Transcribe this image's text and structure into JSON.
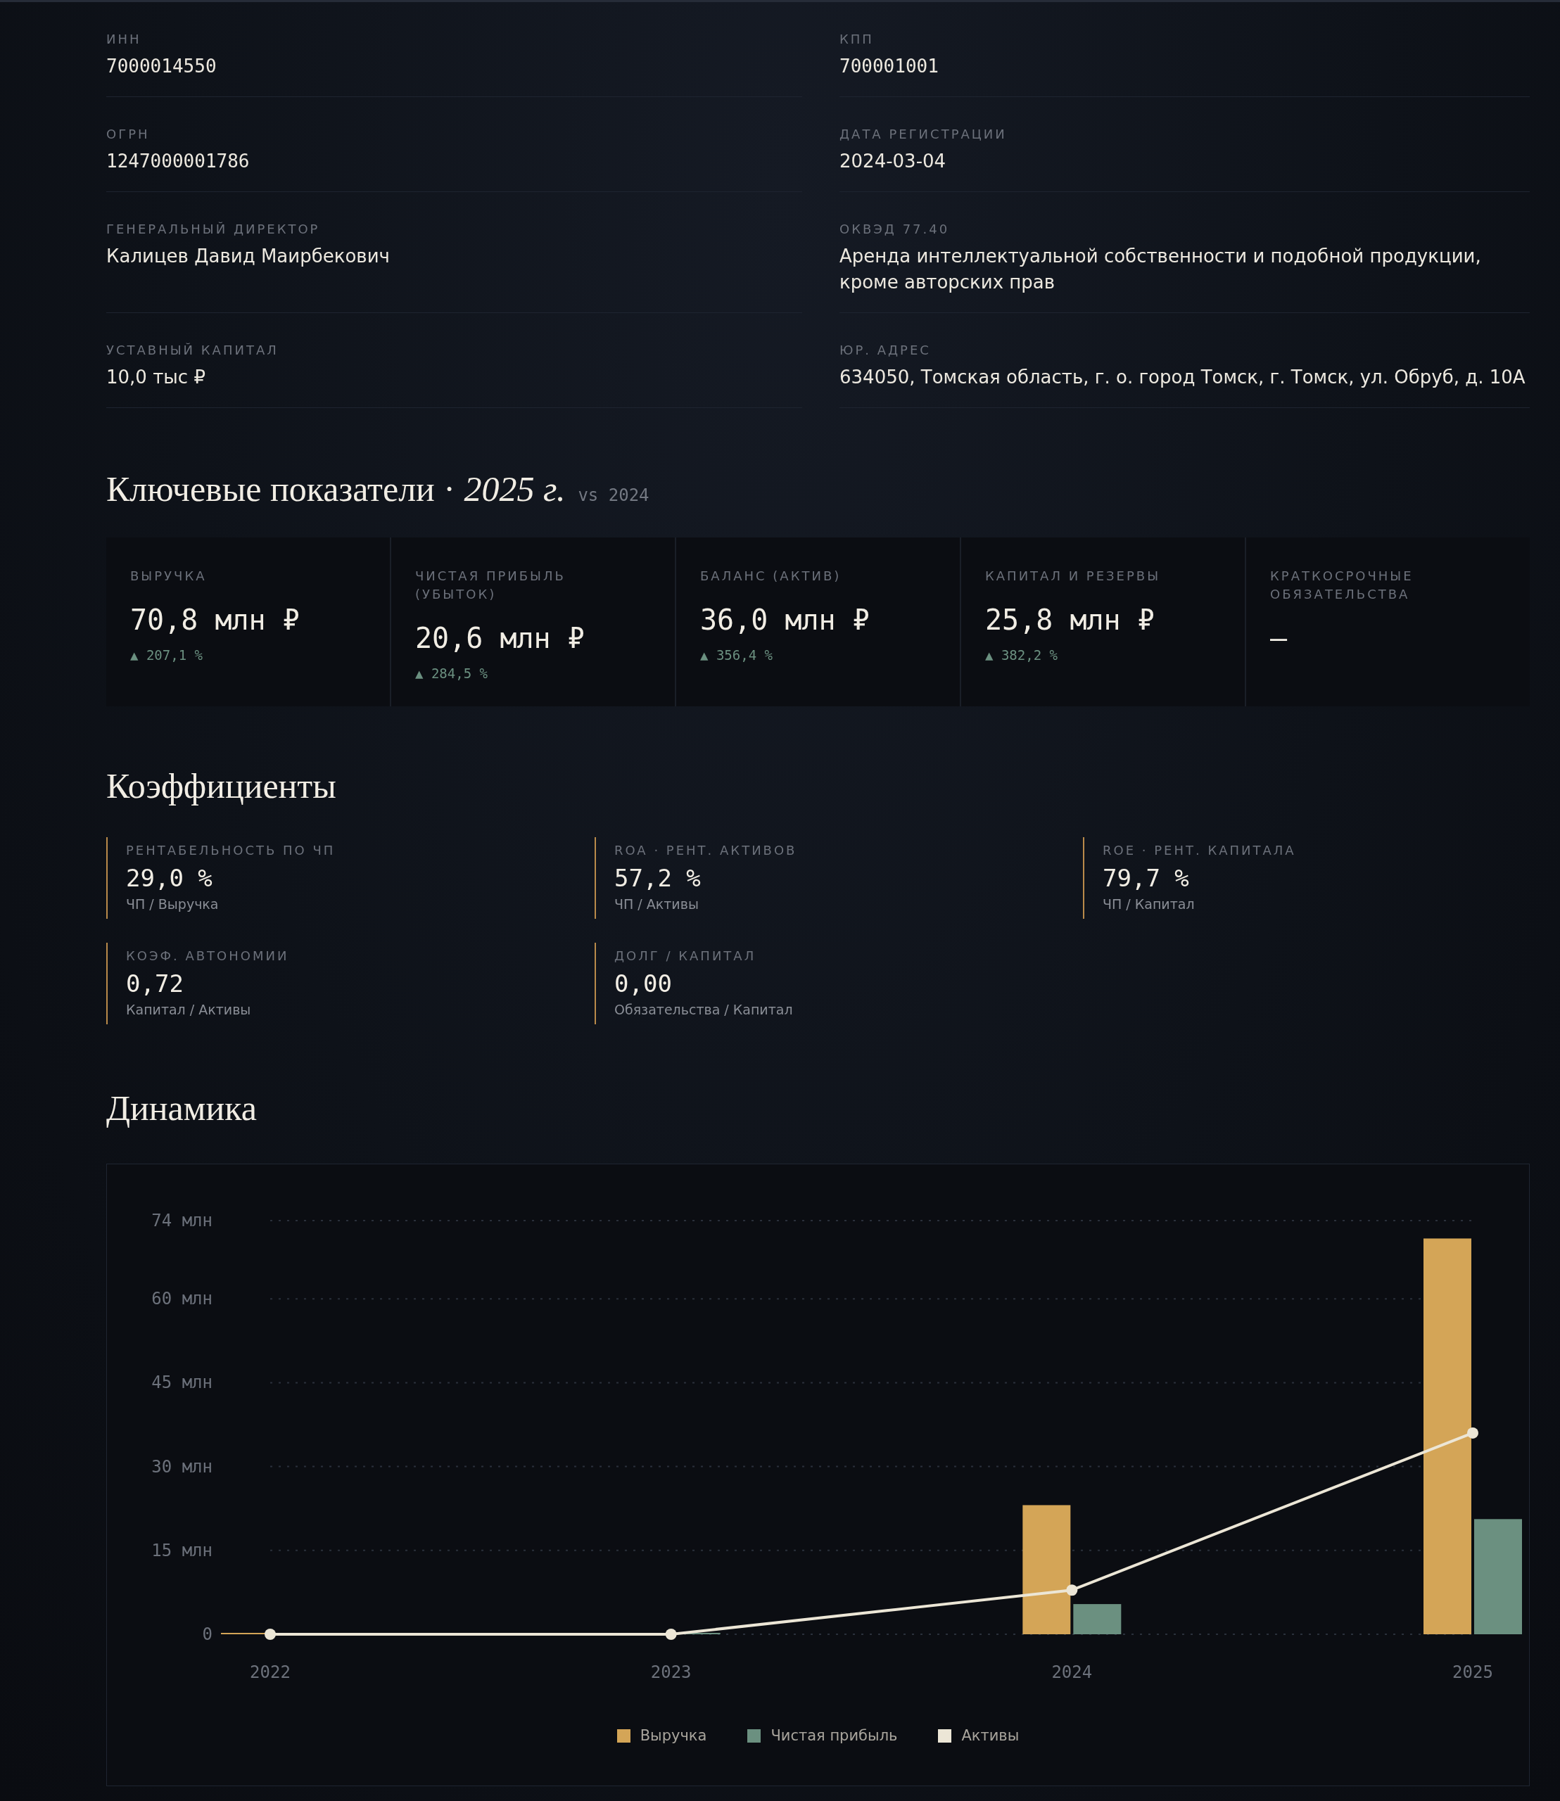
{
  "requisites": [
    {
      "label": "ИНН",
      "value": "7000014550",
      "kind": "code"
    },
    {
      "label": "КПП",
      "value": "700001001",
      "kind": "code"
    },
    {
      "label": "ОГРН",
      "value": "1247000001786",
      "kind": "code"
    },
    {
      "label": "ДАТА РЕГИСТРАЦИИ",
      "value": "2024-03-04",
      "kind": "text"
    },
    {
      "label": "ГЕНЕРАЛЬНЫЙ ДИРЕКТОР",
      "value": "Калицев Давид Маирбекович",
      "kind": "text"
    },
    {
      "label": "ОКВЭД 77.40",
      "value": "Аренда интеллектуальной собственности и подобной продукции, кроме авторских прав",
      "kind": "text"
    },
    {
      "label": "УСТАВНЫЙ КАПИТАЛ",
      "value": "10,0 тыс ₽",
      "kind": "text"
    },
    {
      "label": "ЮР. АДРЕС",
      "value": "634050, Томская область, г. о. город Томск, г. Томск, ул. Обруб, д. 10А",
      "kind": "text"
    }
  ],
  "key_metrics": {
    "title": "Ключевые показатели · *2025 г.*",
    "comparison": "vs 2024",
    "cards": [
      {
        "label": "ВЫРУЧКА",
        "value": "70,8 млн ₽",
        "delta": "▲ 207,1 %"
      },
      {
        "label": "ЧИСТАЯ ПРИБЫЛЬ (УБЫТОК)",
        "value": "20,6 млн ₽",
        "delta": "▲ 284,5 %"
      },
      {
        "label": "БАЛАНС (АКТИВ)",
        "value": "36,0 млн ₽",
        "delta": "▲ 356,4 %"
      },
      {
        "label": "КАПИТАЛ И РЕЗЕРВЫ",
        "value": "25,8 млн ₽",
        "delta": "▲ 382,2 %"
      },
      {
        "label": "КРАТКОСРОЧНЫЕ ОБЯЗАТЕЛЬСТВА",
        "value": "—"
      }
    ]
  },
  "ratios": {
    "title": "Коэффициенты",
    "items": [
      {
        "label": "РЕНТАБЕЛЬНОСТЬ ПО ЧП",
        "value": "29,0 %",
        "formula": "ЧП / Выручка"
      },
      {
        "label": "ROA · РЕНТ. АКТИВОВ",
        "value": "57,2 %",
        "formula": "ЧП / Активы"
      },
      {
        "label": "ROE · РЕНТ. КАПИТАЛА",
        "value": "79,7 %",
        "formula": "ЧП / Капитал"
      },
      {
        "label": "КОЭФ. АВТОНОМИИ",
        "value": "0,72",
        "formula": "Капитал / Активы"
      },
      {
        "label": "ДОЛГ / КАПИТАЛ",
        "value": "0,00",
        "formula": "Обязательства / Капитал"
      }
    ]
  },
  "dynamics": {
    "title": "Динамика",
    "chart_data": {
      "type": "bar",
      "categories": [
        "2022",
        "2023",
        "2024",
        "2025"
      ],
      "series": [
        {
          "name": "Выручка",
          "color": "#d4a557",
          "values": [
            0,
            0,
            23.1,
            70.8
          ]
        },
        {
          "name": "Чистая прибыль",
          "color": "#6b9080",
          "values": [
            0,
            0,
            5.4,
            20.6
          ]
        },
        {
          "name": "Активы",
          "color": "#ece6d6",
          "values": [
            0,
            0,
            7.9,
            36.0
          ],
          "type": "line",
          "marker": "circle"
        }
      ],
      "ylim": [
        0,
        74
      ],
      "grid": true,
      "yticks": [
        {
          "value": 0,
          "label": "0"
        },
        {
          "value": 15,
          "label": "15 млн"
        },
        {
          "value": 30,
          "label": "30 млн"
        },
        {
          "value": 45,
          "label": "45 млн"
        },
        {
          "value": 60,
          "label": "60 млн"
        },
        {
          "value": 74,
          "label": "74 млн"
        }
      ]
    }
  }
}
